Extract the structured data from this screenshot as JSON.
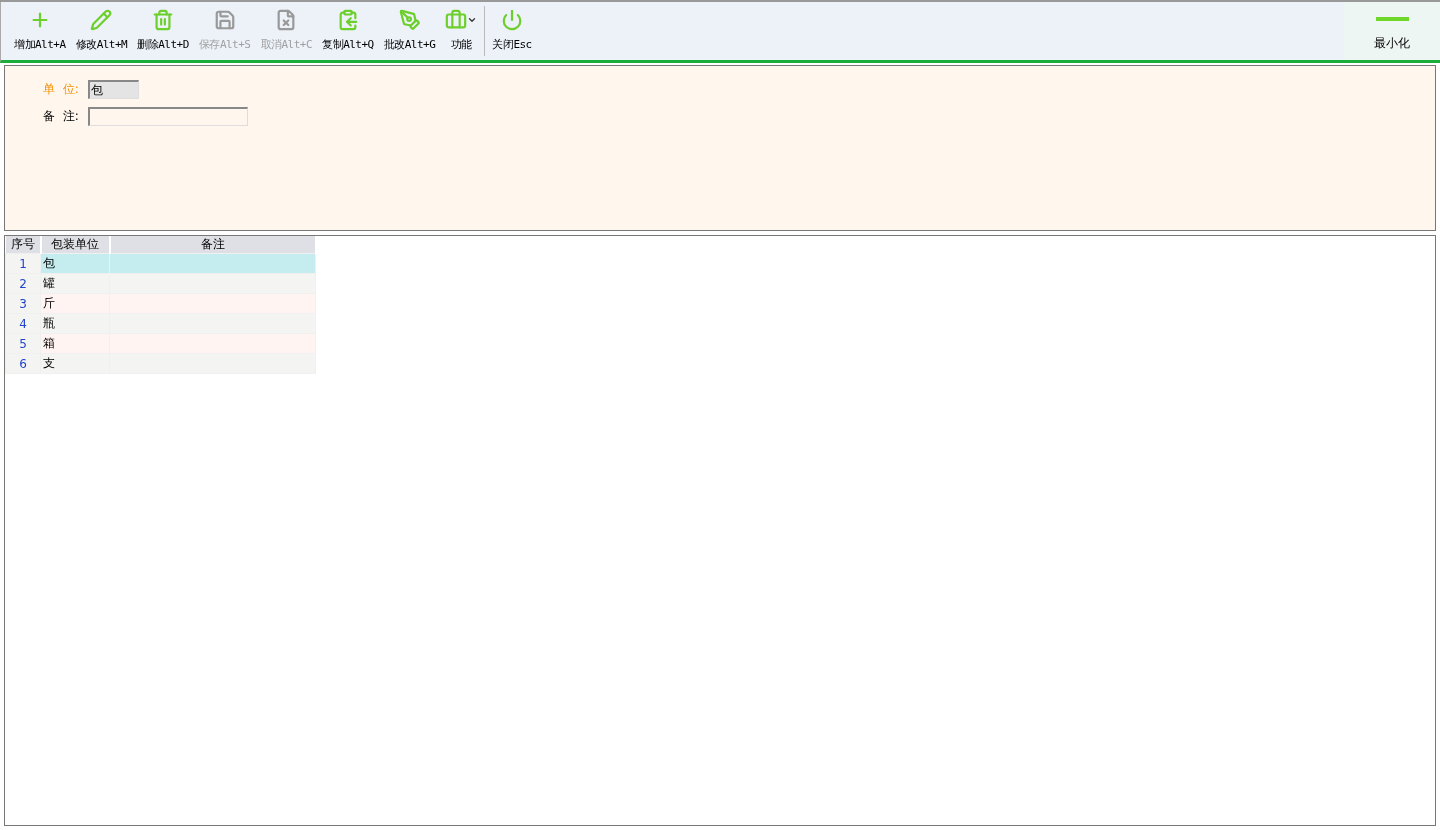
{
  "toolbar": {
    "buttons": [
      {
        "kind": "add",
        "label": "增加Alt+A",
        "disabled": false
      },
      {
        "kind": "edit",
        "label": "修改Alt+M",
        "disabled": false
      },
      {
        "kind": "delete",
        "label": "删除Alt+D",
        "disabled": false
      },
      {
        "kind": "save",
        "label": "保存Alt+S",
        "disabled": true
      },
      {
        "kind": "cancel",
        "label": "取消Alt+C",
        "disabled": true
      },
      {
        "kind": "copy",
        "label": "复制Alt+Q",
        "disabled": false
      },
      {
        "kind": "batch",
        "label": "批改Alt+G",
        "disabled": false
      },
      {
        "kind": "functions",
        "label": "功能",
        "disabled": false
      },
      {
        "kind": "close",
        "label": "关闭Esc",
        "disabled": false
      }
    ],
    "minimize": {
      "label": "最小化"
    }
  },
  "form": {
    "fields": [
      {
        "label": "单  位:",
        "value": "包",
        "required": true,
        "readonly": true
      },
      {
        "label": "备  注:",
        "required": false,
        "readonly": false
      }
    ]
  },
  "table": {
    "columns": [
      "序号",
      "包装单位",
      "备注"
    ],
    "rows": [
      {
        "index": "1",
        "unit": "包",
        "selected": true
      },
      {
        "index": "2",
        "unit": "罐",
        "selected": false
      },
      {
        "index": "3",
        "unit": "斤",
        "selected": false
      },
      {
        "index": "4",
        "unit": "瓶",
        "selected": false
      },
      {
        "index": "5",
        "unit": "箱",
        "selected": false
      },
      {
        "index": "6",
        "unit": "支",
        "selected": false
      }
    ]
  }
}
